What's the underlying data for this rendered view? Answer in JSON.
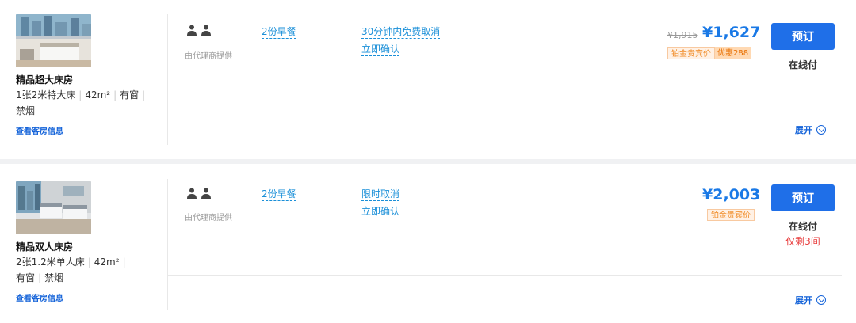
{
  "rooms": [
    {
      "name": "精品超大床房",
      "bed": "1张2米特大床",
      "area": "42m²",
      "window": "有窗",
      "smoke": "禁烟",
      "view_info": "查看客房信息",
      "provider": "由代理商提供",
      "breakfast": "2份早餐",
      "cancel_policy": "30分钟内免费取消",
      "confirm": "立即确认",
      "original_price": "¥1,915",
      "price": "¥1,627",
      "member_tag": "铂金贵宾价",
      "discount_tag": "优惠288",
      "book": "预订",
      "pay_type": "在线付",
      "remaining": "",
      "expand": "展开"
    },
    {
      "name": "精品双人床房",
      "bed": "2张1.2米单人床",
      "area": "42m²",
      "window": "有窗",
      "smoke": "禁烟",
      "view_info": "查看客房信息",
      "provider": "由代理商提供",
      "breakfast": "2份早餐",
      "cancel_policy": "限时取消",
      "confirm": "立即确认",
      "original_price": "",
      "price": "¥2,003",
      "member_tag": "铂金贵宾价",
      "discount_tag": "",
      "book": "预订",
      "pay_type": "在线付",
      "remaining": "仅剩3间",
      "expand": "展开"
    }
  ],
  "colors": {
    "link_blue": "#1a8fd8",
    "price_blue": "#1a79e6",
    "button_blue": "#1f6fe8",
    "tag_orange": "#f08a24",
    "warning_red": "#e83b3b"
  },
  "icons": {
    "guests": "person-icon",
    "expand": "chevron-down-icon"
  }
}
